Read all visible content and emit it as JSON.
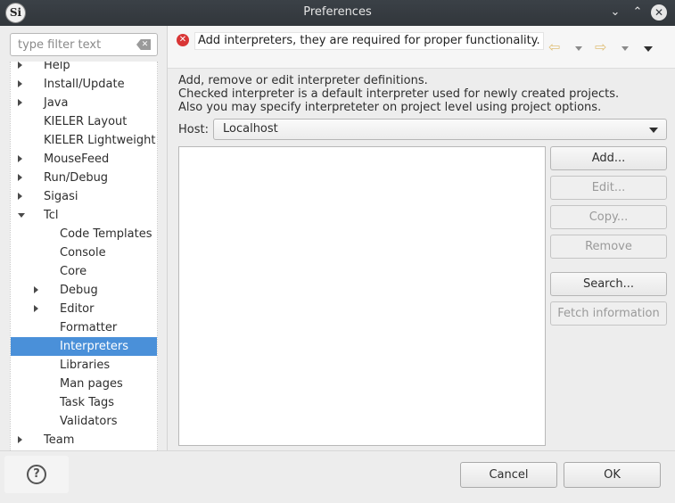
{
  "window": {
    "title": "Preferences",
    "app_icon_text": "Si",
    "controls": {
      "minimize": "⌄",
      "maximize": "⌃",
      "close": "✕"
    }
  },
  "filter": {
    "placeholder": "type filter text"
  },
  "tree": {
    "items": [
      {
        "label": "Help",
        "level": 0,
        "expander": "collapsed"
      },
      {
        "label": "Install/Update",
        "level": 0,
        "expander": "collapsed"
      },
      {
        "label": "Java",
        "level": 0,
        "expander": "collapsed"
      },
      {
        "label": "KIELER Layout",
        "level": 0,
        "expander": "none"
      },
      {
        "label": "KIELER Lightweight D",
        "level": 0,
        "expander": "none"
      },
      {
        "label": "MouseFeed",
        "level": 0,
        "expander": "collapsed"
      },
      {
        "label": "Run/Debug",
        "level": 0,
        "expander": "collapsed"
      },
      {
        "label": "Sigasi",
        "level": 0,
        "expander": "collapsed"
      },
      {
        "label": "Tcl",
        "level": 0,
        "expander": "expanded"
      },
      {
        "label": "Code Templates",
        "level": 1,
        "expander": "none"
      },
      {
        "label": "Console",
        "level": 1,
        "expander": "none"
      },
      {
        "label": "Core",
        "level": 1,
        "expander": "none"
      },
      {
        "label": "Debug",
        "level": 1,
        "expander": "collapsed"
      },
      {
        "label": "Editor",
        "level": 1,
        "expander": "collapsed"
      },
      {
        "label": "Formatter",
        "level": 1,
        "expander": "none"
      },
      {
        "label": "Interpreters",
        "level": 1,
        "expander": "none",
        "selected": true
      },
      {
        "label": "Libraries",
        "level": 1,
        "expander": "none"
      },
      {
        "label": "Man pages",
        "level": 1,
        "expander": "none"
      },
      {
        "label": "Task Tags",
        "level": 1,
        "expander": "none"
      },
      {
        "label": "Validators",
        "level": 1,
        "expander": "none"
      },
      {
        "label": "Team",
        "level": 0,
        "expander": "collapsed"
      }
    ]
  },
  "message": {
    "text": "Add interpreters, they are required for proper functionality.",
    "icon": "error-icon",
    "back_icon": "⇦",
    "forward_icon": "⇨"
  },
  "page": {
    "description": [
      "Add, remove or edit interpreter definitions.",
      "Checked interpreter is a default interpreter used for newly created projects.",
      "Also you may specify interpreteter on project level using project options."
    ],
    "host_label": "Host:",
    "host_value": "Localhost",
    "buttons": {
      "add": "Add...",
      "edit": "Edit...",
      "copy": "Copy...",
      "remove": "Remove",
      "search": "Search...",
      "fetch": "Fetch information"
    }
  },
  "footer": {
    "help_icon": "?",
    "cancel": "Cancel",
    "ok": "OK"
  },
  "colors": {
    "selection": "#4a90d9",
    "error": "#d93636",
    "titlebar": "#31363b"
  }
}
